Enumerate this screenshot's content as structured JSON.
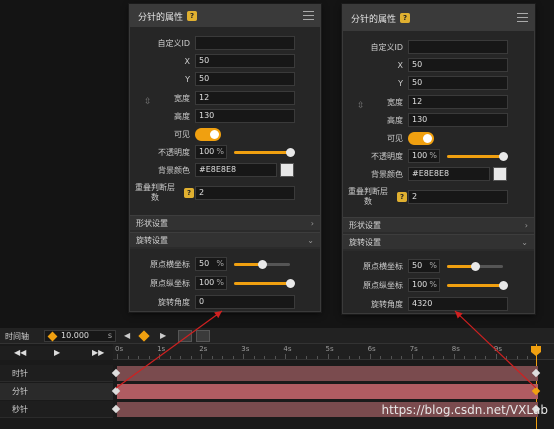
{
  "colors": {
    "accent": "#f0a010",
    "arrow": "#d02020",
    "track": "#7a4b4e",
    "track_selected": "#b05c62"
  },
  "left_panel": {
    "title": "分针的属性",
    "fields": {
      "custom_id_label": "自定义ID",
      "custom_id_value": "",
      "x_label": "X",
      "x_value": "50",
      "y_label": "Y",
      "y_value": "50",
      "width_label": "宽度",
      "width_value": "12",
      "height_label": "高度",
      "height_value": "130",
      "visible_label": "可见",
      "opacity_label": "不透明度",
      "opacity_value": "100",
      "bg_label": "背景颜色",
      "bg_value": "#E8E8E8",
      "overlap_label": "重叠判断层数",
      "overlap_value": "2"
    },
    "shape_section": "形状设置",
    "rotate_section": "旋转设置",
    "rotate": {
      "ox_label": "原点横坐标",
      "ox_value": "50",
      "oy_label": "原点纵坐标",
      "oy_value": "100",
      "angle_label": "旋转角度",
      "angle_value": "0"
    }
  },
  "right_panel": {
    "title": "分针的属性",
    "fields": {
      "custom_id_label": "自定义ID",
      "custom_id_value": "",
      "x_label": "X",
      "x_value": "50",
      "y_label": "Y",
      "y_value": "50",
      "width_label": "宽度",
      "width_value": "12",
      "height_label": "高度",
      "height_value": "130",
      "visible_label": "可见",
      "opacity_label": "不透明度",
      "opacity_value": "100",
      "bg_label": "背景颜色",
      "bg_value": "#E8E8E8",
      "overlap_label": "重叠判断层数",
      "overlap_value": "2"
    },
    "shape_section": "形状设置",
    "rotate_section": "旋转设置",
    "rotate": {
      "ox_label": "原点横坐标",
      "ox_value": "50",
      "oy_label": "原点纵坐标",
      "oy_value": "100",
      "angle_label": "旋转角度",
      "angle_value": "4320"
    }
  },
  "percent_unit": "%",
  "timeline": {
    "label": "时间轴",
    "duration": "10.000",
    "unit": "s",
    "ticks": [
      "0s",
      "1s",
      "2s",
      "3s",
      "4s",
      "5s",
      "6s",
      "7s",
      "8s",
      "9s"
    ],
    "tracks": [
      "时针",
      "分针",
      "秒针"
    ]
  },
  "watermark": "https://blog.csdn.net/VXLab"
}
